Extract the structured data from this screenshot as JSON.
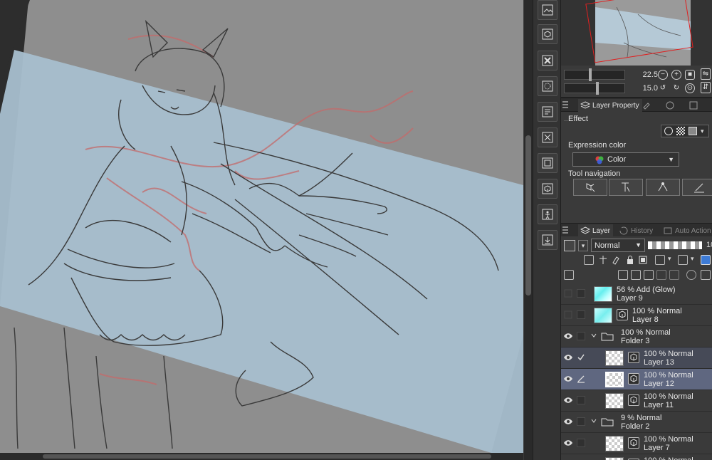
{
  "navigator": {
    "zoom_value": "22.5",
    "rotation_value": "15.0"
  },
  "layer_property": {
    "tabs": [
      {
        "label": "Layer Property",
        "active": true
      },
      {
        "label": "",
        "active": false
      },
      {
        "label": "",
        "active": false
      },
      {
        "label": "",
        "active": false
      }
    ],
    "effect_label": "Effect",
    "expression_color_label": "Expression color",
    "color_value": "Color",
    "tool_navigation_label": "Tool navigation"
  },
  "layer_panel": {
    "tabs": [
      {
        "label": "Layer",
        "active": true
      },
      {
        "label": "History",
        "active": false
      },
      {
        "label": "Auto Action",
        "active": false
      }
    ],
    "blend_mode": "Normal",
    "opacity_value": "10",
    "layers": [
      {
        "top": "56 % Add (Glow)",
        "name": "Layer 9",
        "kind": "raster-glow",
        "visible": false,
        "indent": 0
      },
      {
        "top": "100 % Normal",
        "name": "Layer 8",
        "kind": "vector-glow",
        "visible": false,
        "indent": 0
      },
      {
        "top": "100 % Normal",
        "name": "Folder 3",
        "kind": "folder",
        "visible": true,
        "indent": 0
      },
      {
        "top": "100 % Normal",
        "name": "Layer 13",
        "kind": "vector",
        "visible": true,
        "indent": 1,
        "status": "check"
      },
      {
        "top": "100 % Normal",
        "name": "Layer 12",
        "kind": "vector",
        "visible": true,
        "indent": 1,
        "status": "pen",
        "selected": true
      },
      {
        "top": "100 % Normal",
        "name": "Layer 11",
        "kind": "vector",
        "visible": true,
        "indent": 1
      },
      {
        "top": "9 % Normal",
        "name": "Folder 2",
        "kind": "folder",
        "visible": true,
        "indent": 0
      },
      {
        "top": "100 % Normal",
        "name": "Layer 7",
        "kind": "vector",
        "visible": true,
        "indent": 1
      },
      {
        "top": "100 % Normal",
        "name": "",
        "kind": "vector",
        "visible": true,
        "indent": 1
      }
    ]
  },
  "colors": {
    "canvas_bg": "#8f8f8f",
    "blue_overlay": "#a9c0d0",
    "selected_layer": "#5f6780",
    "panel_bg": "#3a3a3a"
  },
  "icons": [
    "image-material-icon",
    "3d-object-icon",
    "delete-icon",
    "tone-icon",
    "story-icon",
    "transform-icon",
    "frame-icon",
    "3d-pose-icon",
    "figure-icon",
    "export-icon"
  ]
}
